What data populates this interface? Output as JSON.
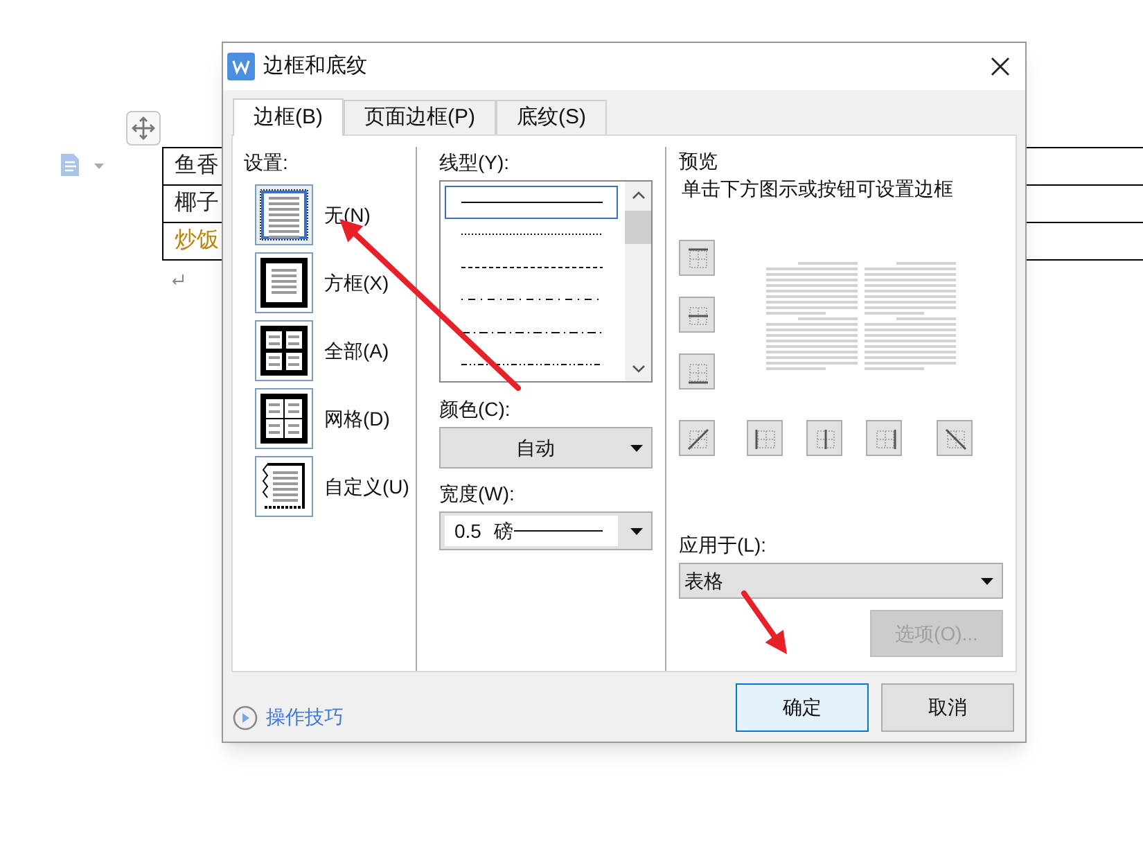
{
  "document": {
    "table_rows": [
      {
        "text": "鱼香",
        "color": "#222222"
      },
      {
        "text": "椰子",
        "color": "#222222"
      },
      {
        "text": "炒饭",
        "color": "#b8860b"
      }
    ]
  },
  "window": {
    "title": "边框和底纹"
  },
  "tabs": [
    {
      "label": "边框(B)",
      "selected": true
    },
    {
      "label": "页面边框(P)",
      "selected": false
    },
    {
      "label": "底纹(S)",
      "selected": false
    }
  ],
  "settings": {
    "label": "设置:",
    "items": [
      {
        "kind": "none",
        "label": "无(N)",
        "selected": true
      },
      {
        "kind": "box",
        "label": "方框(X)",
        "selected": false
      },
      {
        "kind": "all",
        "label": "全部(A)",
        "selected": false
      },
      {
        "kind": "grid",
        "label": "网格(D)",
        "selected": false
      },
      {
        "kind": "custom",
        "label": "自定义(U)",
        "selected": false
      }
    ]
  },
  "line_style": {
    "label": "线型(Y):",
    "items": [
      {
        "kind": "solid",
        "selected": true
      },
      {
        "kind": "dotted",
        "selected": false
      },
      {
        "kind": "dashed",
        "selected": false
      },
      {
        "kind": "dash-dot",
        "selected": false
      },
      {
        "kind": "long-dash-dot",
        "selected": false
      },
      {
        "kind": "dash-dot-dot",
        "selected": false
      }
    ]
  },
  "color": {
    "label": "颜色(C):",
    "value": "自动"
  },
  "width": {
    "label": "宽度(W):",
    "value": "0.5",
    "unit": "磅"
  },
  "preview": {
    "title": "预览",
    "hint": "单击下方图示或按钮可设置边框"
  },
  "apply_to": {
    "label": "应用于(L):",
    "value": "表格"
  },
  "options_button": {
    "label": "选项(O)...",
    "disabled": true
  },
  "help_link": "操作技巧",
  "buttons": [
    {
      "label": "确定",
      "selected": true
    },
    {
      "label": "取消",
      "selected": false
    }
  ]
}
